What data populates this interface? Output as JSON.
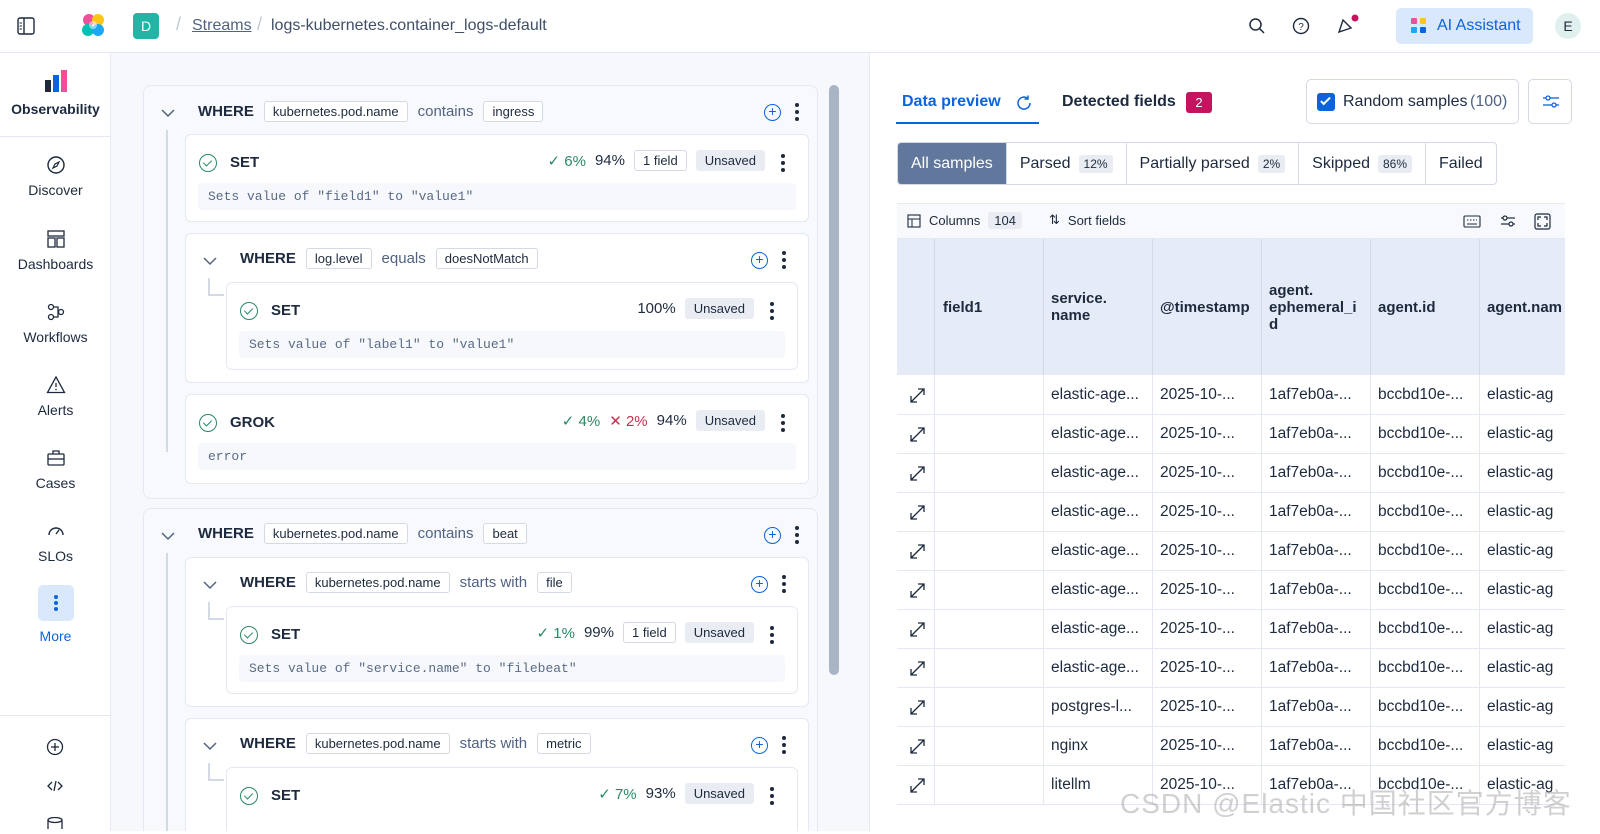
{
  "breadcrumb": {
    "space_letter": "D",
    "streams": "Streams",
    "current": "logs-kubernetes.container_logs-default"
  },
  "header": {
    "ai_assistant": "AI Assistant",
    "avatar": "E"
  },
  "sidebar": {
    "items": [
      {
        "label": "Observability",
        "icon": "observability-logo-icon"
      },
      {
        "label": "Discover",
        "icon": "compass-icon"
      },
      {
        "label": "Dashboards",
        "icon": "dashboard-icon"
      },
      {
        "label": "Workflows",
        "icon": "workflow-icon"
      },
      {
        "label": "Alerts",
        "icon": "alert-triangle-icon"
      },
      {
        "label": "Cases",
        "icon": "briefcase-icon"
      },
      {
        "label": "SLOs",
        "icon": "gauge-icon"
      },
      {
        "label": "More",
        "icon": "more-vertical-icon"
      }
    ]
  },
  "pipeline": {
    "block1": {
      "keyword": "WHERE",
      "field": "kubernetes.pod.name",
      "op": "contains",
      "value": "ingress",
      "set1": {
        "keyword": "SET",
        "pct_ok": "6%",
        "pct": "94%",
        "field_count": "1 field",
        "status": "Unsaved",
        "desc": "Sets value of \"field1\" to \"value1\""
      },
      "where2": {
        "keyword": "WHERE",
        "field": "log.level",
        "op": "equals",
        "value": "doesNotMatch",
        "set": {
          "keyword": "SET",
          "pct": "100%",
          "status": "Unsaved",
          "desc": "Sets value of \"label1\" to \"value1\""
        }
      },
      "grok": {
        "keyword": "GROK",
        "pct_ok": "4%",
        "pct_err": "2%",
        "pct": "94%",
        "status": "Unsaved",
        "desc": "error"
      }
    },
    "block2": {
      "keyword": "WHERE",
      "field": "kubernetes.pod.name",
      "op": "contains",
      "value": "beat",
      "where1": {
        "keyword": "WHERE",
        "field": "kubernetes.pod.name",
        "op": "starts with",
        "value": "file",
        "set": {
          "keyword": "SET",
          "pct_ok": "1%",
          "pct": "99%",
          "field_count": "1 field",
          "status": "Unsaved",
          "desc": "Sets value of \"service.name\" to \"filebeat\""
        }
      },
      "where2": {
        "keyword": "WHERE",
        "field": "kubernetes.pod.name",
        "op": "starts with",
        "value": "metric",
        "set": {
          "keyword": "SET",
          "pct_ok": "7%",
          "pct": "93%",
          "status": "Unsaved"
        }
      }
    }
  },
  "preview": {
    "tab_data_preview": "Data preview",
    "tab_detected_fields": "Detected fields",
    "detected_count": "2",
    "random_samples": "Random samples",
    "random_count": "(100)",
    "filters": [
      {
        "label": "All samples",
        "badge": ""
      },
      {
        "label": "Parsed",
        "badge": "12%"
      },
      {
        "label": "Partially parsed",
        "badge": "2%"
      },
      {
        "label": "Skipped",
        "badge": "86%"
      },
      {
        "label": "Failed",
        "badge": ""
      }
    ],
    "columns_label": "Columns",
    "columns_count": "104",
    "sort_label": "Sort fields",
    "headers": [
      "field1",
      "service.\nname",
      "@timestamp",
      "agent.\nephemeral_i\nd",
      "agent.id",
      "agent.nam"
    ],
    "rows": [
      [
        "",
        "elastic-age...",
        "2025-10-...",
        "1af7eb0a-...",
        "bccbd10e-...",
        "elastic-ag"
      ],
      [
        "",
        "elastic-age...",
        "2025-10-...",
        "1af7eb0a-...",
        "bccbd10e-...",
        "elastic-ag"
      ],
      [
        "",
        "elastic-age...",
        "2025-10-...",
        "1af7eb0a-...",
        "bccbd10e-...",
        "elastic-ag"
      ],
      [
        "",
        "elastic-age...",
        "2025-10-...",
        "1af7eb0a-...",
        "bccbd10e-...",
        "elastic-ag"
      ],
      [
        "",
        "elastic-age...",
        "2025-10-...",
        "1af7eb0a-...",
        "bccbd10e-...",
        "elastic-ag"
      ],
      [
        "",
        "elastic-age...",
        "2025-10-...",
        "1af7eb0a-...",
        "bccbd10e-...",
        "elastic-ag"
      ],
      [
        "",
        "elastic-age...",
        "2025-10-...",
        "1af7eb0a-...",
        "bccbd10e-...",
        "elastic-ag"
      ],
      [
        "",
        "elastic-age...",
        "2025-10-...",
        "1af7eb0a-...",
        "bccbd10e-...",
        "elastic-ag"
      ],
      [
        "",
        "postgres-l...",
        "2025-10-...",
        "1af7eb0a-...",
        "bccbd10e-...",
        "elastic-ag"
      ],
      [
        "",
        "nginx",
        "2025-10-...",
        "1af7eb0a-...",
        "bccbd10e-...",
        "elastic-ag"
      ],
      [
        "",
        "litellm",
        "2025-10-...",
        "1af7eb0a-...",
        "bccbd10e-...",
        "elastic-ag"
      ]
    ]
  },
  "watermark": "CSDN @Elastic 中国社区官方博客",
  "colors": {
    "accent": "#0b64dd",
    "success": "#2a8a63",
    "danger": "#c2334d",
    "badge_pink": "#c4145f"
  }
}
